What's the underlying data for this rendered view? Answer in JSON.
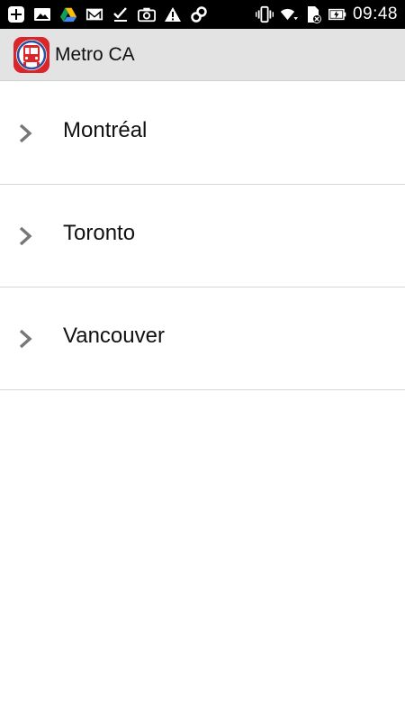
{
  "status_bar": {
    "time": "09:48",
    "left_icons": [
      "plus-box-icon",
      "image-icon",
      "drive-icon",
      "gmail-icon",
      "checkmark-icon",
      "camera-icon",
      "warning-icon",
      "link-icon"
    ],
    "right_icons": [
      "vibrate-icon",
      "wifi-icon",
      "sim-off-icon",
      "battery-charging-icon"
    ]
  },
  "action_bar": {
    "title": "Metro CA",
    "logo_colors": {
      "frame": "#d8262b",
      "inner": "#ffffff",
      "ring": "#2a4f9c"
    }
  },
  "cities": [
    {
      "label": "Montréal"
    },
    {
      "label": "Toronto"
    },
    {
      "label": "Vancouver"
    }
  ],
  "colors": {
    "action_bar_bg": "#e3e3e3",
    "chevron": "#777777",
    "divider": "#d8d8d8"
  }
}
